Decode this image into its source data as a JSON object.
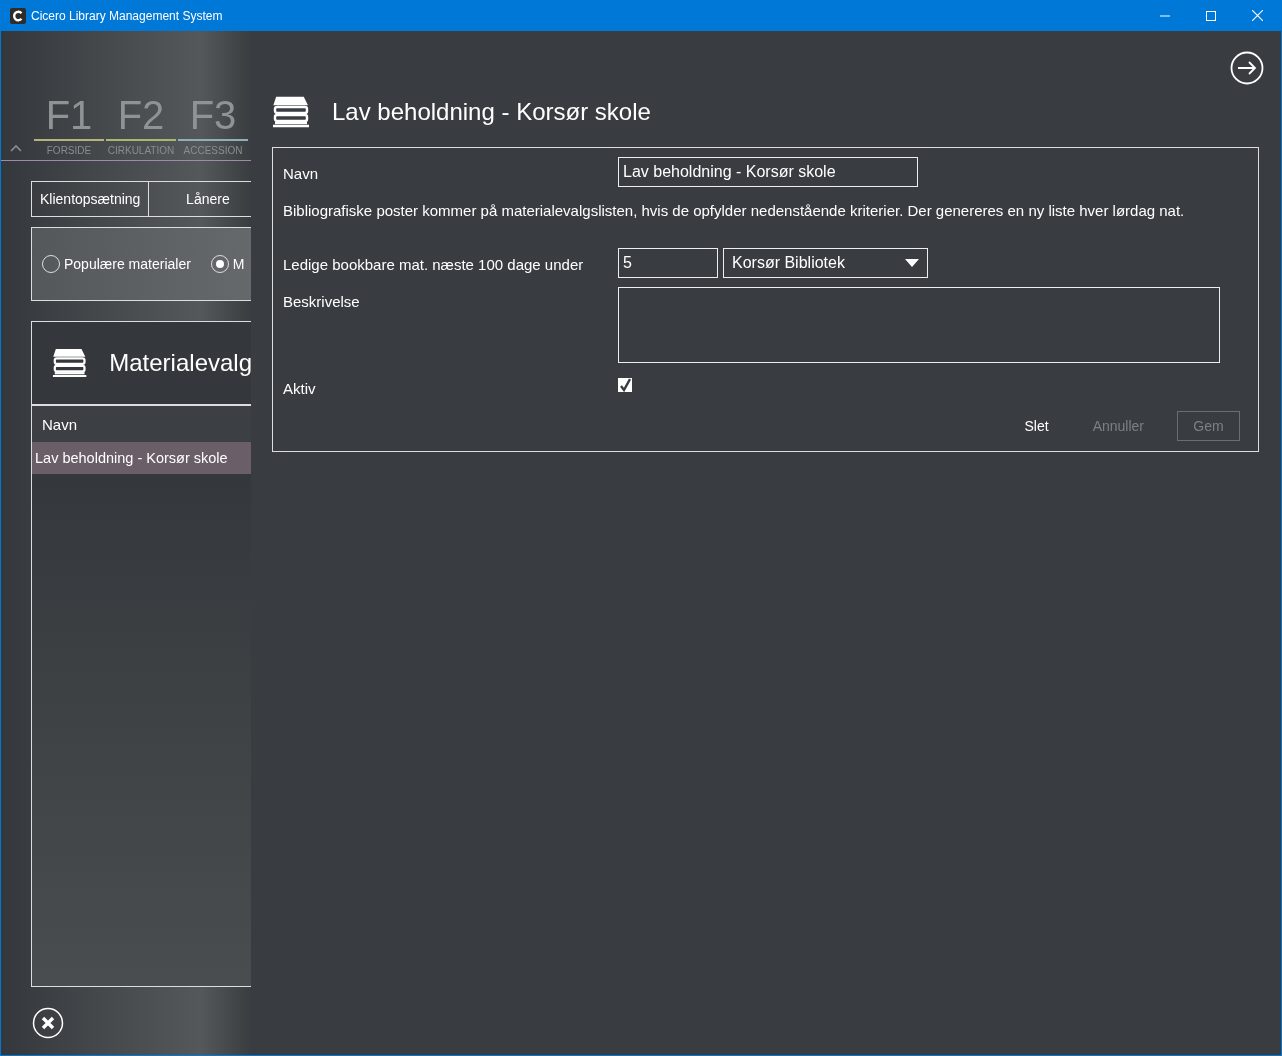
{
  "window": {
    "title": "Cicero Library Management System"
  },
  "function_keys": [
    {
      "key": "F1",
      "label": "FORSIDE",
      "color": "#b8b27c"
    },
    {
      "key": "F2",
      "label": "CIRKULATION",
      "color": "#a9b86c"
    },
    {
      "key": "F3",
      "label": "ACCESSION",
      "color": "#8eb1b9"
    }
  ],
  "tabs": [
    {
      "label": "Klientopsætning"
    },
    {
      "label": "Lånere"
    }
  ],
  "radios": [
    {
      "label": "Populære materialer",
      "selected": false
    },
    {
      "label": "M",
      "selected": true
    }
  ],
  "list_panel": {
    "title": "Materialevalg",
    "column": "Navn",
    "rows": [
      {
        "text": "Lav beholdning - Korsør skole",
        "selected": true
      }
    ]
  },
  "detail": {
    "title": "Lav beholdning - Korsør skole",
    "name_label": "Navn",
    "name_value": "Lav beholdning - Korsør skole",
    "info": "Bibliografiske poster kommer på materialevalgslisten, hvis de opfylder nedenstående kriterier. Der genereres en ny liste hver lørdag nat.",
    "criterion_label": "Ledige bookbare mat. næste 100 dage under",
    "criterion_value": "5",
    "library": "Korsør Bibliotek",
    "description_label": "Beskrivelse",
    "active_label": "Aktiv",
    "active": true,
    "buttons": [
      {
        "label": "Slet",
        "kind": "text",
        "disabled": false
      },
      {
        "label": "Annuller",
        "kind": "text",
        "disabled": true
      },
      {
        "label": "Gem",
        "kind": "outlined",
        "disabled": true
      }
    ]
  }
}
